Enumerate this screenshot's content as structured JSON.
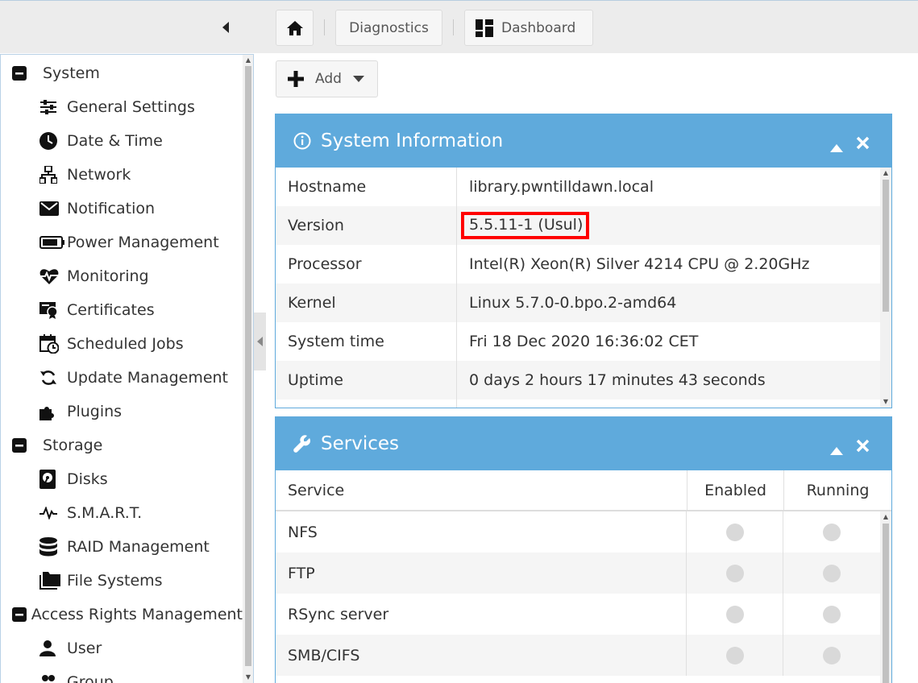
{
  "toolbar": {
    "diagnostics_label": "Diagnostics",
    "dashboard_label": "Dashboard",
    "add_label": "Add"
  },
  "sidebar": {
    "groups": [
      {
        "label": "System",
        "items": [
          "General Settings",
          "Date & Time",
          "Network",
          "Notification",
          "Power Management",
          "Monitoring",
          "Certificates",
          "Scheduled Jobs",
          "Update Management",
          "Plugins"
        ]
      },
      {
        "label": "Storage",
        "items": [
          "Disks",
          "S.M.A.R.T.",
          "RAID Management",
          "File Systems"
        ]
      },
      {
        "label": "Access Rights Management",
        "items": [
          "User",
          "Group"
        ]
      }
    ]
  },
  "system_info": {
    "title": "System Information",
    "rows": [
      {
        "key": "Hostname",
        "value": "library.pwntilldawn.local"
      },
      {
        "key": "Version",
        "value": "5.5.11-1 (Usul)"
      },
      {
        "key": "Processor",
        "value": "Intel(R) Xeon(R) Silver 4214 CPU @ 2.20GHz"
      },
      {
        "key": "Kernel",
        "value": "Linux 5.7.0-0.bpo.2-amd64"
      },
      {
        "key": "System time",
        "value": "Fri 18 Dec 2020 16:36:02 CET"
      },
      {
        "key": "Uptime",
        "value": "0 days 2 hours 17 minutes 43 seconds"
      }
    ]
  },
  "services": {
    "title": "Services",
    "columns": [
      "Service",
      "Enabled",
      "Running"
    ],
    "rows": [
      {
        "name": "NFS",
        "enabled": false,
        "running": false
      },
      {
        "name": "FTP",
        "enabled": false,
        "running": false
      },
      {
        "name": "RSync server",
        "enabled": false,
        "running": false
      },
      {
        "name": "SMB/CIFS",
        "enabled": false,
        "running": false
      }
    ]
  },
  "colors": {
    "panel_header": "#5faadc",
    "highlight": "#ff0000",
    "status_off": "#d9d9d9"
  },
  "icons": [
    "home-icon",
    "dashboard-icon",
    "plus-icon",
    "info-icon",
    "wrench-icon",
    "collapse-icon",
    "close-icon"
  ]
}
